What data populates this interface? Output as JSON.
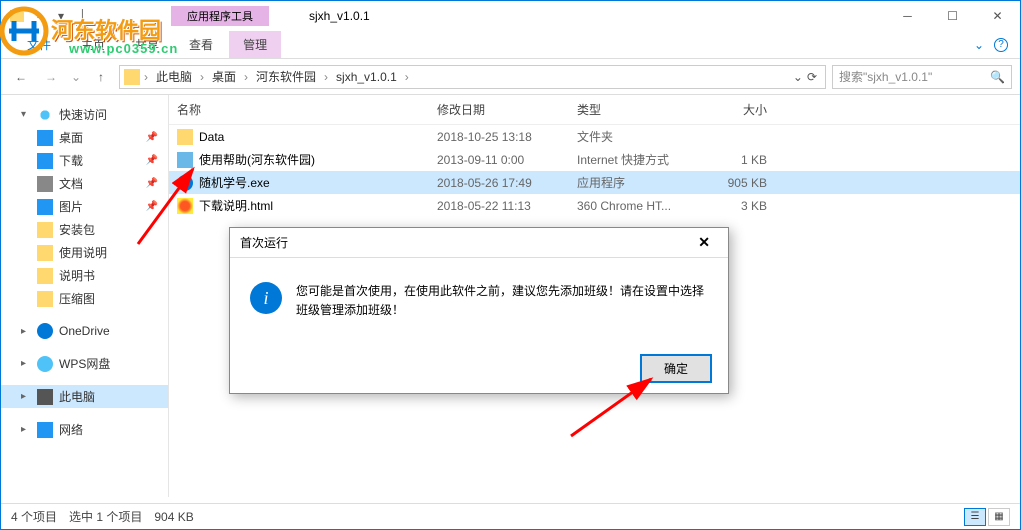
{
  "window": {
    "title": "sjxh_v1.0.1",
    "context_tab": "应用程序工具"
  },
  "ribbon": {
    "tabs": [
      "主页",
      "共享",
      "查看",
      "管理"
    ],
    "active_context": 3
  },
  "breadcrumb": {
    "root": "此电脑",
    "parts": [
      "桌面",
      "河东软件园",
      "sjxh_v1.0.1"
    ]
  },
  "search": {
    "placeholder": "搜索\"sjxh_v1.0.1\""
  },
  "columns": {
    "name": "名称",
    "date": "修改日期",
    "type": "类型",
    "size": "大小"
  },
  "sidebar": {
    "items": [
      {
        "label": "快速访问",
        "icon": "ic-star",
        "exp": "▾"
      },
      {
        "label": "桌面",
        "icon": "ic-desktop",
        "pin": true
      },
      {
        "label": "下载",
        "icon": "ic-down",
        "pin": true
      },
      {
        "label": "文档",
        "icon": "ic-doc",
        "pin": true
      },
      {
        "label": "图片",
        "icon": "ic-pic",
        "pin": true
      },
      {
        "label": "安装包",
        "icon": "ic-folder"
      },
      {
        "label": "使用说明",
        "icon": "ic-folder"
      },
      {
        "label": "说明书",
        "icon": "ic-folder"
      },
      {
        "label": "压缩图",
        "icon": "ic-folder"
      },
      {
        "label": "OneDrive",
        "icon": "ic-onedrive",
        "exp": "▸",
        "gap": true
      },
      {
        "label": "WPS网盘",
        "icon": "ic-wps",
        "exp": "▸",
        "gap": true
      },
      {
        "label": "此电脑",
        "icon": "ic-pc",
        "exp": "▸",
        "gap": true,
        "sel": true
      },
      {
        "label": "网络",
        "icon": "ic-net",
        "exp": "▸",
        "gap": true
      }
    ]
  },
  "files": [
    {
      "name": "Data",
      "icon": "ic-folder",
      "date": "2018-10-25 13:18",
      "type": "文件夹",
      "size": ""
    },
    {
      "name": "使用帮助(河东软件园)",
      "icon": "ic-help",
      "date": "2013-09-11 0:00",
      "type": "Internet 快捷方式",
      "size": "1 KB"
    },
    {
      "name": "随机学号.exe",
      "icon": "ic-exe",
      "date": "2018-05-26 17:49",
      "type": "应用程序",
      "size": "905 KB",
      "sel": true
    },
    {
      "name": "下载说明.html",
      "icon": "ic-html",
      "date": "2018-05-22 11:13",
      "type": "360 Chrome HT...",
      "size": "3 KB"
    }
  ],
  "statusbar": {
    "count": "4 个项目",
    "selected": "选中 1 个项目",
    "size": "904 KB"
  },
  "dialog": {
    "title": "首次运行",
    "message": "您可能是首次使用，在使用此软件之前，建议您先添加班级！请在设置中选择班级管理添加班级！",
    "ok": "确定"
  },
  "watermark": {
    "title": "河东软件园",
    "url": "www.pc0359.cn"
  },
  "colors": {
    "accent": "#0078d7",
    "select": "#cce8ff"
  }
}
